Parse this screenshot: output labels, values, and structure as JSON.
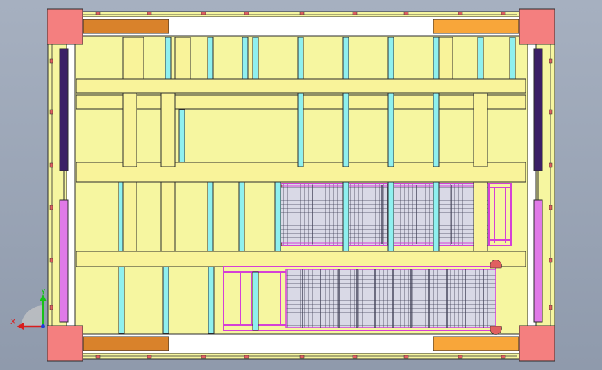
{
  "view": {
    "background_top": "#a6b0c0",
    "background_bottom": "#8f9aac"
  },
  "triad": {
    "x_label": "X",
    "y_label": "Y",
    "x_color": "#d81e1e",
    "y_color": "#17c217",
    "z_color": "#1e3cd8"
  },
  "colors": {
    "frame_outer": "#f6f6a0",
    "frame_inner": "#ffffff",
    "corner_block": "#f47f7f",
    "beam_yellow": "#f9f39a",
    "post_cyan": "#8ff0ef",
    "rail_dark": "#3b1f66",
    "rail_magenta": "#e07ae8",
    "orange_dark": "#d9822b",
    "orange_light": "#f8a63a",
    "grid_magenta": "#d540d6",
    "grid_mesh": "#3f3f55",
    "edge": "#2b2b2b"
  }
}
